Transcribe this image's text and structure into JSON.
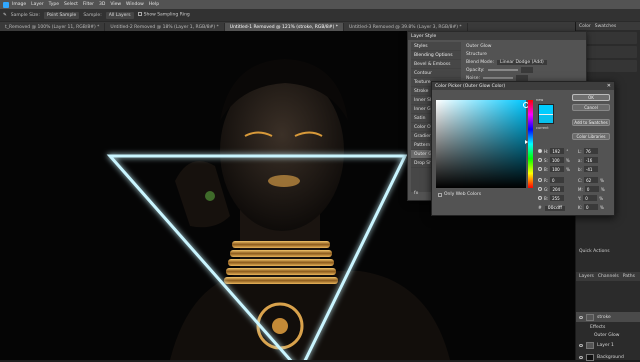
{
  "menubar": {
    "items": [
      "Image",
      "Layer",
      "Type",
      "Select",
      "Filter",
      "3D",
      "View",
      "Window",
      "Help"
    ]
  },
  "options_bar": {
    "sample_size_label": "Sample Size:",
    "sample_size_value": "Point Sample",
    "sample_label": "Sample:",
    "sample_value": "All Layers",
    "show_ring_label": "Show Sampling Ring"
  },
  "tabs": [
    {
      "label": "t_Removed @ 100% (Layer 11, RGB/8#) *",
      "active": false
    },
    {
      "label": "Untitled-2 Removed @ 18% (Layer 1, RGB/8#) *",
      "active": false
    },
    {
      "label": "Untitled-1 Removed @ 121% (stroke, RGB/8#) *",
      "active": true
    },
    {
      "label": "Untitled-3 Removed @ 39.8% (Layer 3, RGB/8#) *",
      "active": false
    }
  ],
  "layer_style": {
    "title": "Layer Style",
    "styles": [
      {
        "label": "Styles",
        "header": true,
        "selected": false
      },
      {
        "label": "Blending Options",
        "header": true,
        "selected": false
      },
      {
        "label": "Bevel & Emboss",
        "header": false,
        "selected": false
      },
      {
        "label": "Contour",
        "header": false,
        "selected": false
      },
      {
        "label": "Texture",
        "header": false,
        "selected": false
      },
      {
        "label": "Stroke",
        "header": false,
        "selected": false
      },
      {
        "label": "Inner Shadow",
        "header": false,
        "selected": false
      },
      {
        "label": "Inner Glow",
        "header": false,
        "selected": false
      },
      {
        "label": "Satin",
        "header": false,
        "selected": false
      },
      {
        "label": "Color Overlay",
        "header": false,
        "selected": false
      },
      {
        "label": "Gradient Overlay",
        "header": false,
        "selected": false
      },
      {
        "label": "Pattern Overlay",
        "header": false,
        "selected": false
      },
      {
        "label": "Outer Glow",
        "header": false,
        "selected": true
      },
      {
        "label": "Drop Shadow",
        "header": false,
        "selected": false
      }
    ],
    "panel_title": "Outer Glow",
    "structure_label": "Structure",
    "blend_mode_label": "Blend Mode:",
    "blend_mode_value": "Linear Dodge (Add)",
    "opacity_label": "Opacity:",
    "noise_label": "Noise:",
    "fx_label": "fx"
  },
  "color_picker": {
    "title": "Color Picker (Outer Glow Color)",
    "new_label": "new",
    "current_label": "current",
    "buttons": [
      "OK",
      "Cancel",
      "Add to Swatches",
      "Color Libraries"
    ],
    "only_web_colors": "Only Web Colors",
    "hex_prefix": "#",
    "hex_value": "00cdff",
    "fields": [
      {
        "label": "H:",
        "value": "192",
        "unit": "°"
      },
      {
        "label": "S:",
        "value": "100",
        "unit": "%"
      },
      {
        "label": "B:",
        "value": "100",
        "unit": "%"
      },
      {
        "label": "R:",
        "value": "0",
        "unit": ""
      },
      {
        "label": "G:",
        "value": "204",
        "unit": ""
      },
      {
        "label": "B:",
        "value": "255",
        "unit": ""
      }
    ],
    "lab_fields": [
      {
        "label": "L:",
        "value": "76"
      },
      {
        "label": "a:",
        "value": "-16"
      },
      {
        "label": "b:",
        "value": "-41"
      },
      {
        "label": "C:",
        "value": "62",
        "unit": "%"
      },
      {
        "label": "M:",
        "value": "0",
        "unit": "%"
      },
      {
        "label": "Y:",
        "value": "0",
        "unit": "%"
      },
      {
        "label": "K:",
        "value": "0",
        "unit": "%"
      }
    ],
    "color": "#00cdff"
  },
  "right_panel": {
    "tabs": [
      "Color",
      "Swatches"
    ],
    "quick_actions": "Quick Actions",
    "layers_tabs": [
      "Layers",
      "Channels",
      "Paths"
    ],
    "layers": [
      {
        "name": "stroke",
        "selected": true
      },
      {
        "name": "Effects",
        "selected": false
      },
      {
        "name": "Outer Glow",
        "selected": false
      },
      {
        "name": "Layer 1",
        "selected": false
      },
      {
        "name": "Background",
        "selected": false
      }
    ]
  },
  "glow_color": "#c9f5ff"
}
